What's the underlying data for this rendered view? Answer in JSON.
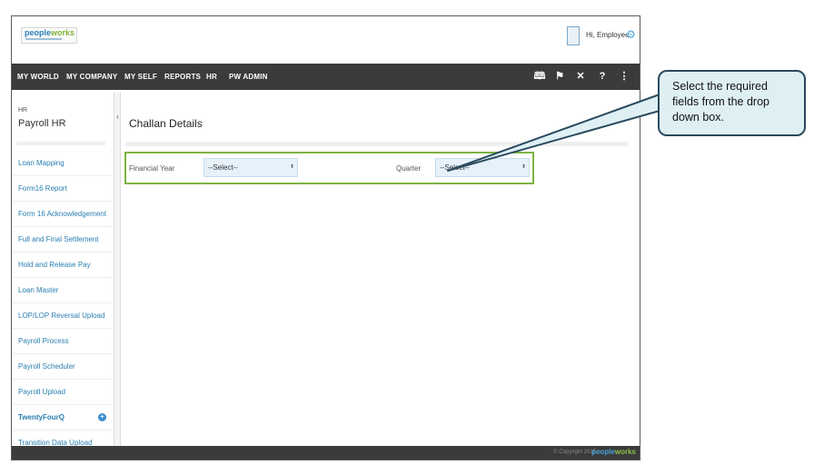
{
  "header": {
    "logo_part1": "people",
    "logo_part2": "works",
    "greeting": "Hi, Employee"
  },
  "nav": {
    "items": [
      "MY WORLD",
      "MY COMPANY",
      "MY SELF",
      "REPORTS",
      "HR",
      "PW ADMIN"
    ],
    "tools": [
      "book-icon",
      "flag-icon",
      "tools-icon",
      "help-icon",
      "sitemap-icon"
    ]
  },
  "sidebar": {
    "section": "HR",
    "title": "Payroll HR",
    "items": [
      "Loan Mapping",
      "Form16 Report",
      "Form 16 Acknowledgement",
      "Full and Final Settlement",
      "Hold and Release Pay",
      "Loan Master",
      "LOP/LOP Reversal Upload",
      "Payroll Process",
      "Payroll Scheduler",
      "Payroll Upload",
      "TwentyFourQ",
      "Transition Data Upload"
    ],
    "active_item": "TwentyFourQ"
  },
  "content": {
    "title": "Challan Details",
    "financial_year_label": "Financial Year",
    "financial_year_value": "--Select--",
    "quarter_label": "Quarter",
    "quarter_value": "--Select--"
  },
  "footer": {
    "copyright": "© Copyright 2015",
    "logo_part1": "people",
    "logo_part2": "works"
  },
  "callout": {
    "text": "Select the required fields from the drop down box."
  },
  "colors": {
    "nav_bg": "#3b3b3b",
    "link": "#2a7fb0",
    "form_border": "#7cb342",
    "select_bg": "#e6f1fa",
    "callout_bg": "#dff0f5"
  }
}
